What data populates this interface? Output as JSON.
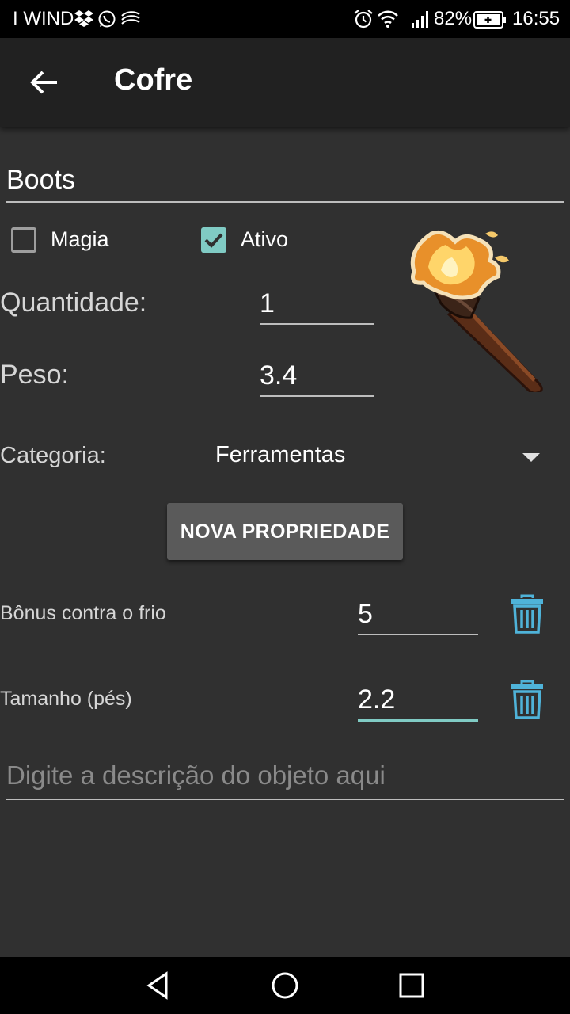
{
  "status_bar": {
    "carrier": "I WIND",
    "battery": "82%",
    "time": "16:55",
    "icons_left": [
      "dropbox-icon",
      "whatsapp-icon",
      "swiftkey-icon"
    ],
    "icons_right": [
      "alarm-icon",
      "wifi-icon",
      "signal-icon",
      "battery-icon"
    ]
  },
  "app_bar": {
    "title": "Cofre",
    "back_icon": "arrow-back-icon"
  },
  "item": {
    "name": "Boots",
    "magia_label": "Magia",
    "magia_checked": false,
    "ativo_label": "Ativo",
    "ativo_checked": true,
    "quantidade_label": "Quantidade:",
    "quantidade_value": "1",
    "peso_label": "Peso:",
    "peso_value": "3.4",
    "categoria_label": "Categoria:",
    "categoria_value": "Ferramentas",
    "image": "torch-icon"
  },
  "nova_propriedade_label": "NOVA PROPRIEDADE",
  "properties": [
    {
      "label": "Bônus contra o frio",
      "value": "5",
      "focused": false
    },
    {
      "label": "Tamanho (pés)",
      "value": "2.2",
      "focused": true
    }
  ],
  "description": {
    "placeholder": "Digite a descrição do objeto aqui"
  },
  "nav_bar": {
    "icons": [
      "nav-back-icon",
      "nav-home-icon",
      "nav-recents-icon"
    ]
  },
  "colors": {
    "background": "#303030",
    "app_bar": "#212121",
    "accent": "#80cbc4",
    "trash_icon": "#4fb3d9",
    "button": "#5a5a5a"
  }
}
